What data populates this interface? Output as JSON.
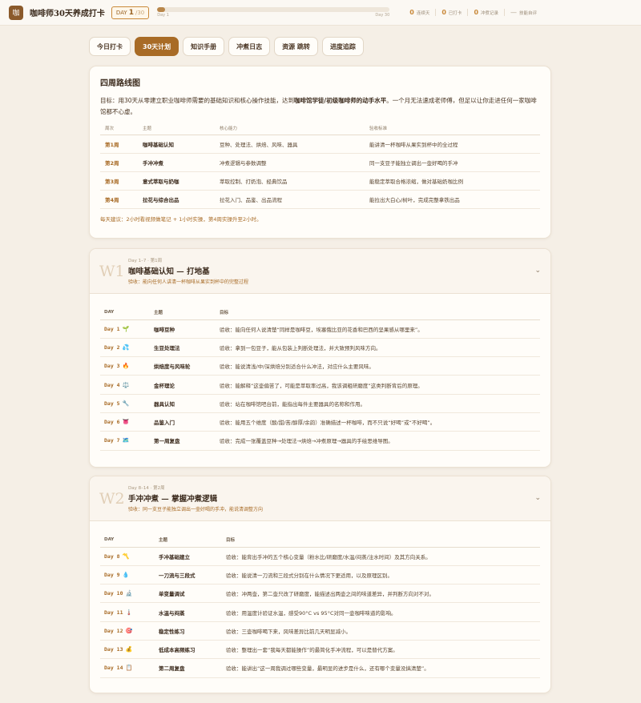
{
  "app": {
    "logo_glyph": "咖",
    "title": "咖啡师30天养成打卡"
  },
  "day_badge": {
    "prefix": "DAY",
    "current": "1",
    "total": "/30"
  },
  "progress": {
    "fraction": 0.033,
    "start_label": "Day 1",
    "end_label": "Day 30"
  },
  "stats": [
    {
      "num": "0",
      "label": "连续天"
    },
    {
      "num": "0",
      "label": "已打卡"
    },
    {
      "num": "0",
      "label": "冲煮记录"
    },
    {
      "num": "—",
      "label": "技能自评"
    }
  ],
  "tabs": [
    "今日打卡",
    "30天计划",
    "知识手册",
    "冲煮日志",
    "资源 跳转",
    "进度追踪"
  ],
  "active_tab": 1,
  "overview": {
    "title": "四周路线图",
    "goal_pre": "目标：用30天从零建立职业咖啡师需要的基础知识和核心操作技能，达到",
    "goal_bold": "咖啡馆学徒/初级咖啡师的动手水平",
    "goal_post": "。一个月无法速成老师傅，但足以让你走进任何一家咖啡馆都不心虚。",
    "headers": [
      "周次",
      "主题",
      "核心能力",
      "验收标准"
    ],
    "rows": [
      [
        "第1周",
        "咖啡基础认知",
        "豆种、处理法、烘焙、风味、器具",
        "能讲清一杯咖啡从果实到杯中的全过程"
      ],
      [
        "第2周",
        "手冲冲煮",
        "冲煮逻辑与参数调整",
        "同一支豆子能独立调出一壶好喝的手冲"
      ],
      [
        "第3周",
        "意式萃取与奶咖",
        "萃取控制、打奶泡、经典饮品",
        "能稳定萃取合格浓缩，做对基础奶咖比例"
      ],
      [
        "第4周",
        "拉花与综合出品",
        "拉花入门、品鉴、出品流程",
        "能拉出大白心/树叶，完成完整拿铁出品"
      ]
    ],
    "footer": "每天建议：2小时看视频做笔记 + 1小时实操，第4周实操升至2小时。"
  },
  "weeks": [
    {
      "big": "W1",
      "meta": "Day 1–7 · 第1周",
      "title": "咖啡基础认知 — 打地基",
      "subtitle": "验收：能向任何人讲清一杯咖啡从果实到杯中的完整过程",
      "headers": [
        "DAY",
        "主题",
        "目标"
      ],
      "days": [
        {
          "day": "Day 1",
          "icon": "🌱",
          "topic": "咖啡豆种",
          "goal": "验收：能向任何人说清楚“同样是咖啡豆，埃塞俄比亚的花香和巴西的坚果感从哪里来”。"
        },
        {
          "day": "Day 2",
          "icon": "💦",
          "topic": "生豆处理法",
          "goal": "验收：拿到一包豆子，能从包装上判断处理法，并大致预判风味方向。"
        },
        {
          "day": "Day 3",
          "icon": "🔥",
          "topic": "烘焙度与风味轮",
          "goal": "验收：能说清浅/中/深烘焙分别适合什么冲法，对应什么主要风味。"
        },
        {
          "day": "Day 4",
          "icon": "⚖️",
          "topic": "金杯理论",
          "goal": "验收：能解释“这壶偏苦了，可能是萃取率过高，我该调粗研磨度”这类判断背后的原理。"
        },
        {
          "day": "Day 5",
          "icon": "🔧",
          "topic": "器具认知",
          "goal": "验收：站在咖啡馆吧台前，能指出每件主要器具的名称和作用。"
        },
        {
          "day": "Day 6",
          "icon": "👅",
          "topic": "品鉴入门",
          "goal": "验收：能用五个维度（酸/甜/苦/醇厚/余韵）准确描述一杯咖啡，而不只说“好喝”或“不好喝”。"
        },
        {
          "day": "Day 7",
          "icon": "🗺️",
          "topic": "第一周复盘",
          "goal": "验收：完成一张覆盖豆种→处理法→烘焙→冲煮原理→器具的手绘思维导图。"
        }
      ]
    },
    {
      "big": "W2",
      "meta": "Day 8–14 · 第2周",
      "title": "手冲冲煮 — 掌握冲煮逻辑",
      "subtitle": "验收：同一支豆子能独立调出一壶好喝的手冲，能说清调整方向",
      "headers": [
        "DAY",
        "主题",
        "目标"
      ],
      "days": [
        {
          "day": "Day 8",
          "icon": "〽️",
          "topic": "手冲基础建立",
          "goal": "验收：能背出手冲的五个核心变量（粉水比/研磨度/水温/闷蒸/注水时间）及其方向关系。"
        },
        {
          "day": "Day 9",
          "icon": "💧",
          "topic": "一刀流与三段式",
          "goal": "验收：能说清一刀流和三段式分别在什么情况下更适用，以及原理区别。"
        },
        {
          "day": "Day 10",
          "icon": "🔬",
          "topic": "单变量调试",
          "goal": "验收：冲两壶，第二壶只改了研磨度，能描述出两壶之间的味道差异，并判断方向对不对。"
        },
        {
          "day": "Day 11",
          "icon": "🌡️",
          "topic": "水温与闷蒸",
          "goal": "验收：用温度计验证水温，感受90°C vs 95°C对同一壶咖啡味道的影响。"
        },
        {
          "day": "Day 12",
          "icon": "🎯",
          "topic": "稳定性练习",
          "goal": "验收：三壶咖啡喝下来，风味差异比前几天明显减小。"
        },
        {
          "day": "Day 13",
          "icon": "💰",
          "topic": "低成本高频练习",
          "goal": "验收：整理出一套“我每天都能操作”的最简化手冲流程，可以是替代方案。"
        },
        {
          "day": "Day 14",
          "icon": "📋",
          "topic": "第二周复盘",
          "goal": "验收：能讲出“这一周我调过哪些变量，最明显的进步是什么，还有哪个变量没搞清楚”。"
        }
      ]
    }
  ]
}
